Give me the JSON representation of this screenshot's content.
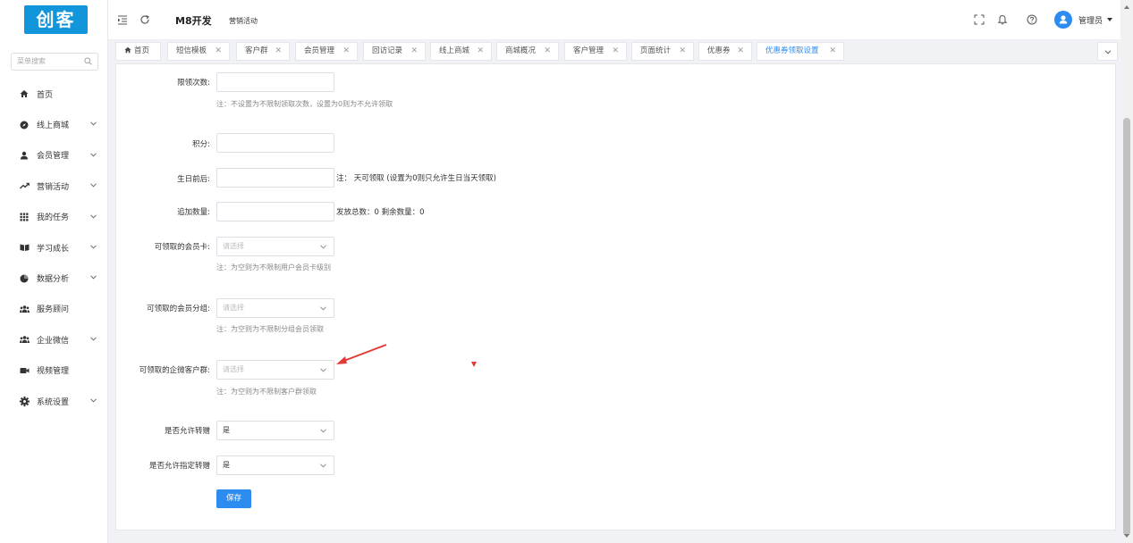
{
  "app": {
    "logo_text": "创客"
  },
  "sidebar": {
    "search_placeholder": "菜单搜索",
    "items": [
      {
        "label": "首页",
        "icon": "home-icon",
        "expandable": false
      },
      {
        "label": "线上商城",
        "icon": "compass-icon",
        "expandable": true
      },
      {
        "label": "会员管理",
        "icon": "user-icon",
        "expandable": true
      },
      {
        "label": "营销活动",
        "icon": "trend-icon",
        "expandable": true
      },
      {
        "label": "我的任务",
        "icon": "grid-icon",
        "expandable": true
      },
      {
        "label": "学习成长",
        "icon": "book-icon",
        "expandable": true
      },
      {
        "label": "数据分析",
        "icon": "pie-icon",
        "expandable": true
      },
      {
        "label": "服务顾问",
        "icon": "group-icon",
        "expandable": false
      },
      {
        "label": "企业微信",
        "icon": "group-icon",
        "expandable": true
      },
      {
        "label": "视频管理",
        "icon": "video-icon",
        "expandable": false
      },
      {
        "label": "系统设置",
        "icon": "gear-icon",
        "expandable": true
      }
    ]
  },
  "header": {
    "title": "M8开发",
    "breadcrumb": "营销活动",
    "user": "管理员"
  },
  "tabs": [
    {
      "label": "首页",
      "closable": false,
      "active": false
    },
    {
      "label": "短信模板",
      "closable": true,
      "active": false
    },
    {
      "label": "客户群",
      "closable": true,
      "active": false
    },
    {
      "label": "会员管理",
      "closable": true,
      "active": false
    },
    {
      "label": "回访记录",
      "closable": true,
      "active": false
    },
    {
      "label": "线上商城",
      "closable": true,
      "active": false
    },
    {
      "label": "商城概况",
      "closable": true,
      "active": false
    },
    {
      "label": "客户管理",
      "closable": true,
      "active": false
    },
    {
      "label": "页面统计",
      "closable": true,
      "active": false
    },
    {
      "label": "优惠券",
      "closable": true,
      "active": false
    },
    {
      "label": "优惠券领取设置",
      "closable": true,
      "active": true
    }
  ],
  "form": {
    "limit_label": "限领次数:",
    "limit_value": "",
    "limit_hint": "注：不设置为不限制领取次数，设置为0则为不允许领取",
    "points_label": "积分:",
    "points_value": "",
    "birthday_label": "生日前后:",
    "birthday_value": "",
    "birthday_hint": "注：  天可领取 (设置为0则只允许生日当天领取)",
    "add_qty_label": "追加数量:",
    "add_qty_value": "",
    "qty_info": "发放总数：0 剩余数量：0",
    "member_card_label": "可领取的会员卡:",
    "member_card_placeholder": "请选择",
    "member_card_hint": "注：为空则为不限制用户会员卡级别",
    "member_group_label": "可领取的会员分组:",
    "member_group_placeholder": "请选择",
    "member_group_hint": "注：为空则为不限制分组会员领取",
    "wecom_group_label": "可领取的企微客户群:",
    "wecom_group_placeholder": "请选择",
    "wecom_group_hint": "注：为空则为不限制客户群领取",
    "allow_transfer_label": "是否允许转赠",
    "allow_transfer_value": "是",
    "allow_designated_label": "是否允许指定转赠",
    "allow_designated_value": "是",
    "save_label": "保存"
  },
  "colors": {
    "primary": "#2d8cf0",
    "logo_bg": "#1296db",
    "annotation": "#e53935"
  }
}
